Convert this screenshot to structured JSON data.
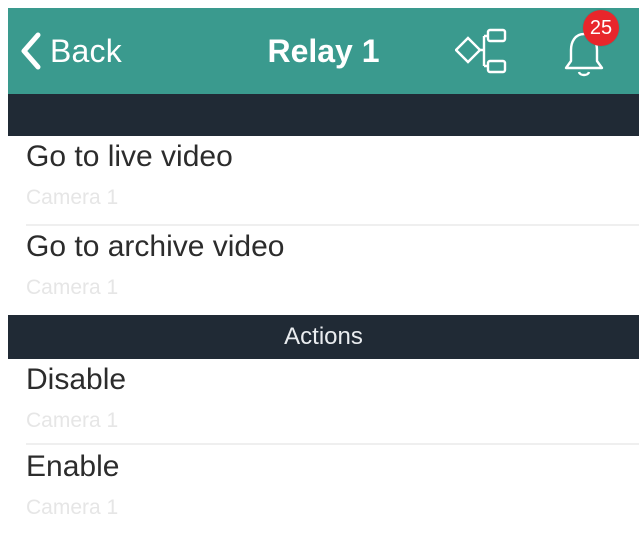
{
  "header": {
    "back_label": "Back",
    "title": "Relay 1",
    "notification_count": "25",
    "bar_color": "#3a9a8e",
    "badge_color": "#e8262b"
  },
  "sections": {
    "top_label": "",
    "actions_label": "Actions",
    "bg_color": "#202a35"
  },
  "items": [
    {
      "label": "Go to live video",
      "subtitle": "Camera 1"
    },
    {
      "label": "Go to archive video",
      "subtitle": "Camera 1"
    },
    {
      "label": "Disable",
      "subtitle": "Camera 1"
    },
    {
      "label": "Enable",
      "subtitle": "Camera 1"
    }
  ]
}
